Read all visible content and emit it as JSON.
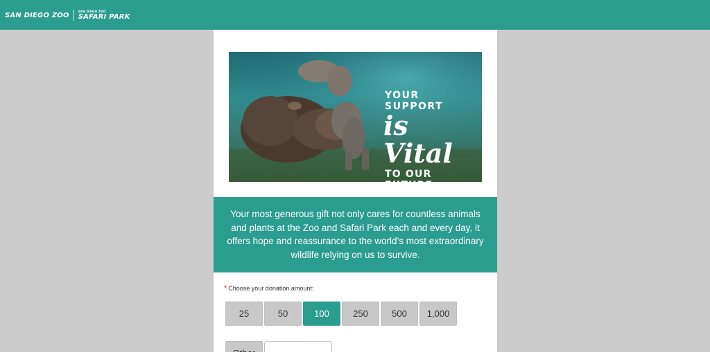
{
  "header": {
    "logo_zoo": "SAN DIEGO ZOO",
    "logo_safari_small": "SAN DIEGO ZOO",
    "logo_safari": "SAFARI PARK"
  },
  "hero": {
    "line1": "YOUR SUPPORT",
    "line2": "is Vital",
    "line3": "TO OUR FUTURE"
  },
  "message": "Your most generous gift not only cares for countless animals and plants at the Zoo and Safari Park each and every day, it offers hope and reassurance to the world’s most extraordinary wildlife relying on us to survive.",
  "form": {
    "required_marker": "*",
    "label": "Choose your donation amount:",
    "amounts": [
      "25",
      "50",
      "100",
      "250",
      "500",
      "1,000"
    ],
    "selected_amount": "100",
    "other_label": "Other",
    "other_value": ""
  },
  "colors": {
    "brand": "#2a9d8f",
    "page_background": "#cccccc",
    "button": "#c8c8c8"
  }
}
